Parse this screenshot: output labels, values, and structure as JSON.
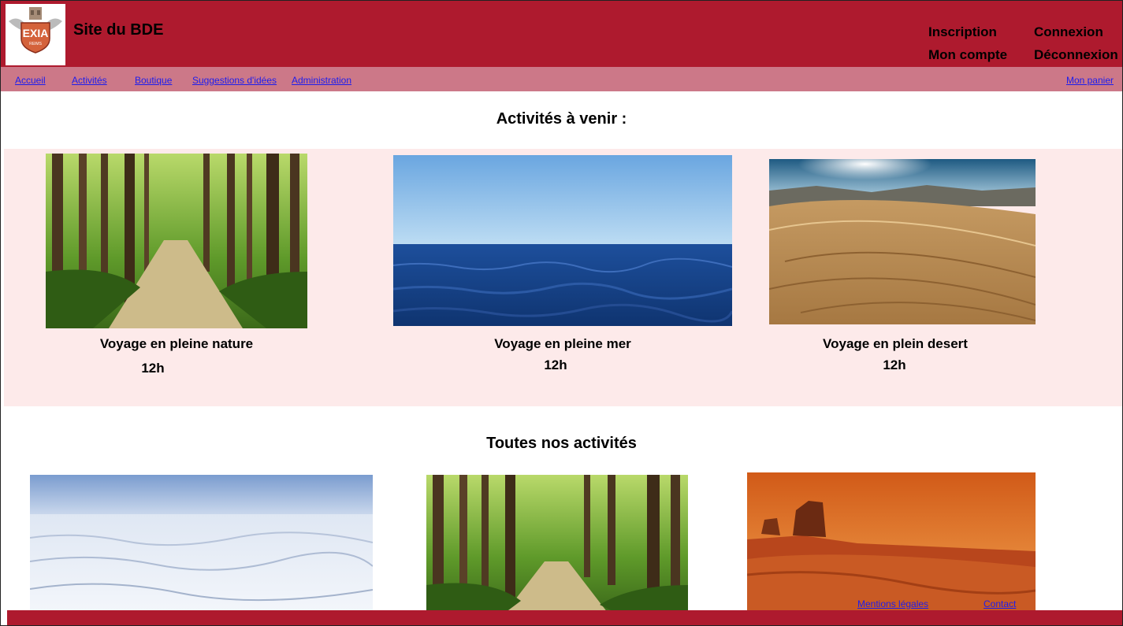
{
  "site": {
    "title": "Site du BDE",
    "logo_text": "EXIA",
    "logo_subtext": "REIMS"
  },
  "header_links": {
    "inscription": "Inscription",
    "connexion": "Connexion",
    "mon_compte": "Mon compte",
    "deconnexion": "Déconnexion"
  },
  "nav": {
    "items": [
      "Accueil",
      "Activités",
      "Boutique",
      "Suggestions d'idées",
      "Administration"
    ],
    "cart": "Mon panier"
  },
  "upcoming": {
    "title": "Activités à venir :",
    "cards": [
      {
        "title": "Voyage en pleine nature",
        "time": "12h",
        "image": "forest-path"
      },
      {
        "title": "Voyage en pleine mer",
        "time": "12h",
        "image": "sea-horizon"
      },
      {
        "title": "Voyage en plein desert",
        "time": "12h",
        "image": "desert-dunes"
      }
    ]
  },
  "all": {
    "title": "Toutes nos activités",
    "cards": [
      {
        "image": "snow-field"
      },
      {
        "image": "forest-path"
      },
      {
        "image": "red-rocks"
      }
    ]
  },
  "footer": {
    "mentions": "Mentions légales",
    "contact": "Contact"
  },
  "colors": {
    "header": "#ae1a2e",
    "nav": "#cc7888",
    "band": "#fdeaea",
    "link": "#1d1ded"
  }
}
